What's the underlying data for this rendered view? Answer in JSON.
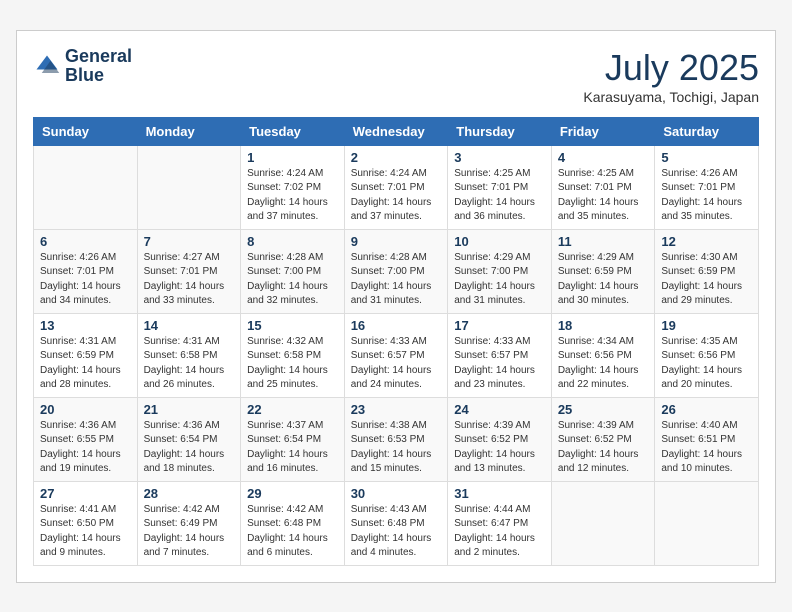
{
  "header": {
    "logo_line1": "General",
    "logo_line2": "Blue",
    "month_year": "July 2025",
    "location": "Karasuyama, Tochigi, Japan"
  },
  "days_of_week": [
    "Sunday",
    "Monday",
    "Tuesday",
    "Wednesday",
    "Thursday",
    "Friday",
    "Saturday"
  ],
  "weeks": [
    [
      {
        "day": "",
        "info": ""
      },
      {
        "day": "",
        "info": ""
      },
      {
        "day": "1",
        "info": "Sunrise: 4:24 AM\nSunset: 7:02 PM\nDaylight: 14 hours and 37 minutes."
      },
      {
        "day": "2",
        "info": "Sunrise: 4:24 AM\nSunset: 7:01 PM\nDaylight: 14 hours and 37 minutes."
      },
      {
        "day": "3",
        "info": "Sunrise: 4:25 AM\nSunset: 7:01 PM\nDaylight: 14 hours and 36 minutes."
      },
      {
        "day": "4",
        "info": "Sunrise: 4:25 AM\nSunset: 7:01 PM\nDaylight: 14 hours and 35 minutes."
      },
      {
        "day": "5",
        "info": "Sunrise: 4:26 AM\nSunset: 7:01 PM\nDaylight: 14 hours and 35 minutes."
      }
    ],
    [
      {
        "day": "6",
        "info": "Sunrise: 4:26 AM\nSunset: 7:01 PM\nDaylight: 14 hours and 34 minutes."
      },
      {
        "day": "7",
        "info": "Sunrise: 4:27 AM\nSunset: 7:01 PM\nDaylight: 14 hours and 33 minutes."
      },
      {
        "day": "8",
        "info": "Sunrise: 4:28 AM\nSunset: 7:00 PM\nDaylight: 14 hours and 32 minutes."
      },
      {
        "day": "9",
        "info": "Sunrise: 4:28 AM\nSunset: 7:00 PM\nDaylight: 14 hours and 31 minutes."
      },
      {
        "day": "10",
        "info": "Sunrise: 4:29 AM\nSunset: 7:00 PM\nDaylight: 14 hours and 31 minutes."
      },
      {
        "day": "11",
        "info": "Sunrise: 4:29 AM\nSunset: 6:59 PM\nDaylight: 14 hours and 30 minutes."
      },
      {
        "day": "12",
        "info": "Sunrise: 4:30 AM\nSunset: 6:59 PM\nDaylight: 14 hours and 29 minutes."
      }
    ],
    [
      {
        "day": "13",
        "info": "Sunrise: 4:31 AM\nSunset: 6:59 PM\nDaylight: 14 hours and 28 minutes."
      },
      {
        "day": "14",
        "info": "Sunrise: 4:31 AM\nSunset: 6:58 PM\nDaylight: 14 hours and 26 minutes."
      },
      {
        "day": "15",
        "info": "Sunrise: 4:32 AM\nSunset: 6:58 PM\nDaylight: 14 hours and 25 minutes."
      },
      {
        "day": "16",
        "info": "Sunrise: 4:33 AM\nSunset: 6:57 PM\nDaylight: 14 hours and 24 minutes."
      },
      {
        "day": "17",
        "info": "Sunrise: 4:33 AM\nSunset: 6:57 PM\nDaylight: 14 hours and 23 minutes."
      },
      {
        "day": "18",
        "info": "Sunrise: 4:34 AM\nSunset: 6:56 PM\nDaylight: 14 hours and 22 minutes."
      },
      {
        "day": "19",
        "info": "Sunrise: 4:35 AM\nSunset: 6:56 PM\nDaylight: 14 hours and 20 minutes."
      }
    ],
    [
      {
        "day": "20",
        "info": "Sunrise: 4:36 AM\nSunset: 6:55 PM\nDaylight: 14 hours and 19 minutes."
      },
      {
        "day": "21",
        "info": "Sunrise: 4:36 AM\nSunset: 6:54 PM\nDaylight: 14 hours and 18 minutes."
      },
      {
        "day": "22",
        "info": "Sunrise: 4:37 AM\nSunset: 6:54 PM\nDaylight: 14 hours and 16 minutes."
      },
      {
        "day": "23",
        "info": "Sunrise: 4:38 AM\nSunset: 6:53 PM\nDaylight: 14 hours and 15 minutes."
      },
      {
        "day": "24",
        "info": "Sunrise: 4:39 AM\nSunset: 6:52 PM\nDaylight: 14 hours and 13 minutes."
      },
      {
        "day": "25",
        "info": "Sunrise: 4:39 AM\nSunset: 6:52 PM\nDaylight: 14 hours and 12 minutes."
      },
      {
        "day": "26",
        "info": "Sunrise: 4:40 AM\nSunset: 6:51 PM\nDaylight: 14 hours and 10 minutes."
      }
    ],
    [
      {
        "day": "27",
        "info": "Sunrise: 4:41 AM\nSunset: 6:50 PM\nDaylight: 14 hours and 9 minutes."
      },
      {
        "day": "28",
        "info": "Sunrise: 4:42 AM\nSunset: 6:49 PM\nDaylight: 14 hours and 7 minutes."
      },
      {
        "day": "29",
        "info": "Sunrise: 4:42 AM\nSunset: 6:48 PM\nDaylight: 14 hours and 6 minutes."
      },
      {
        "day": "30",
        "info": "Sunrise: 4:43 AM\nSunset: 6:48 PM\nDaylight: 14 hours and 4 minutes."
      },
      {
        "day": "31",
        "info": "Sunrise: 4:44 AM\nSunset: 6:47 PM\nDaylight: 14 hours and 2 minutes."
      },
      {
        "day": "",
        "info": ""
      },
      {
        "day": "",
        "info": ""
      }
    ]
  ]
}
